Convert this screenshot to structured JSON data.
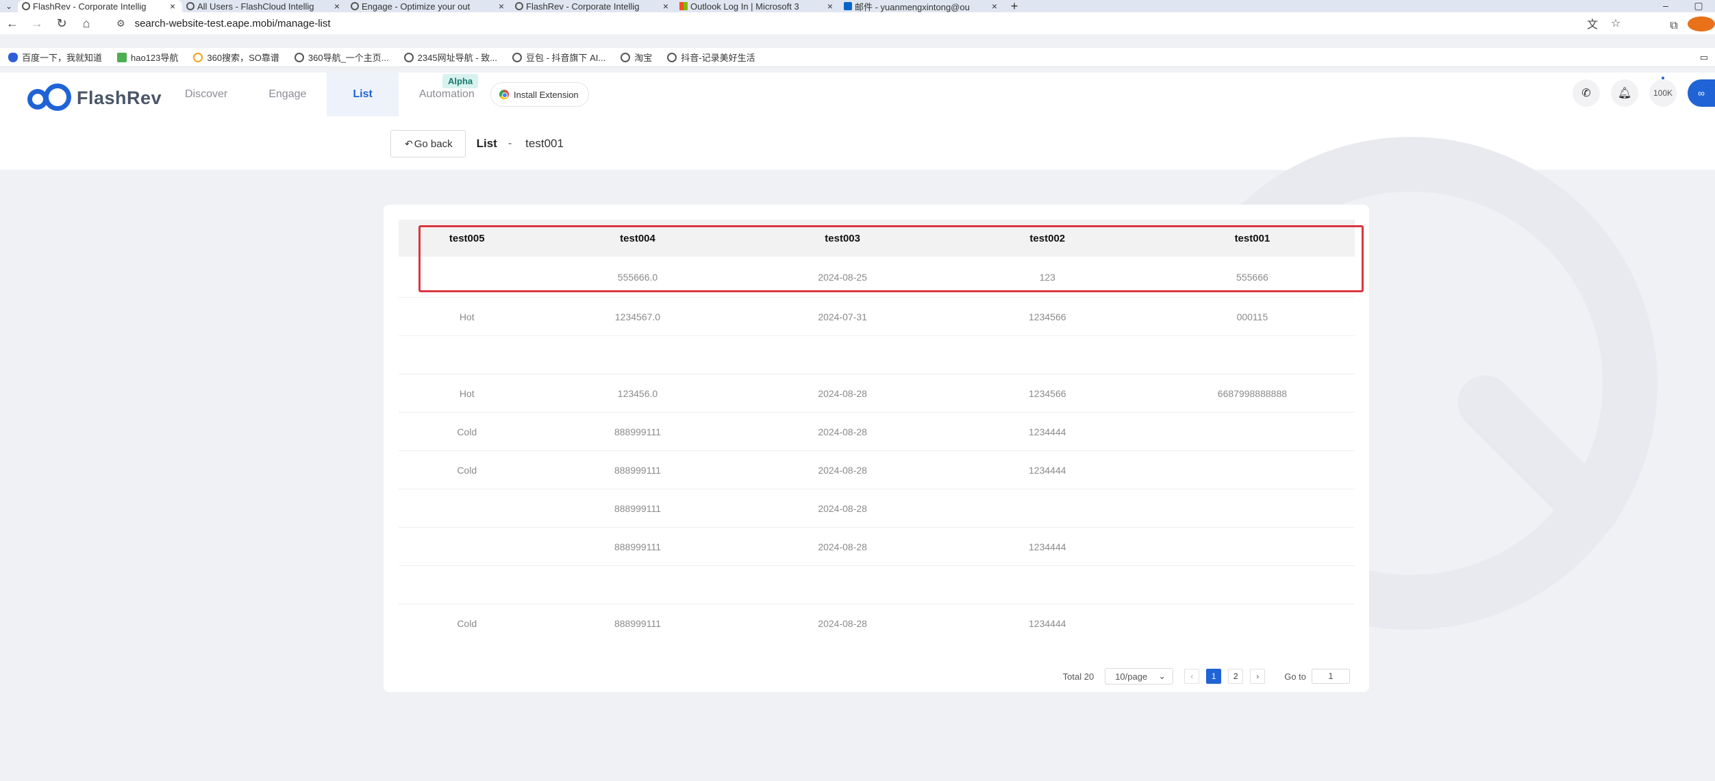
{
  "browser": {
    "tabs": [
      {
        "title": "FlashRev - Corporate Intellig",
        "active": true,
        "icon": "flashrev-icon"
      },
      {
        "title": "All Users - FlashCloud Intellig",
        "active": false,
        "icon": "globe-icon"
      },
      {
        "title": "Engage - Optimize your out",
        "active": false,
        "icon": "flashrev-icon"
      },
      {
        "title": "FlashRev - Corporate Intellig",
        "active": false,
        "icon": "flashrev-icon"
      },
      {
        "title": "Outlook Log In | Microsoft 3",
        "active": false,
        "icon": "microsoft-icon"
      },
      {
        "title": "邮件 - yuanmengxintong@ou",
        "active": false,
        "icon": "outlook-icon"
      }
    ],
    "new_tab": "+",
    "url": "search-website-test.eape.mobi/manage-list",
    "bookmarks": [
      "百度一下，我就知道",
      "hao123导航",
      "360搜索，SO靠谱",
      "360导航_一个主页...",
      "2345网址导航 - 致...",
      "豆包 - 抖音旗下 AI...",
      "淘宝",
      "抖音-记录美好生活"
    ]
  },
  "header": {
    "logo_text": "FlashRev",
    "nav": [
      {
        "label": "Discover",
        "active": false
      },
      {
        "label": "Engage",
        "active": false
      },
      {
        "label": "List",
        "active": true
      },
      {
        "label": "Automation",
        "active": false
      }
    ],
    "alpha_badge": "Alpha",
    "install_extension": "Install Extension",
    "credits": "100K"
  },
  "subheader": {
    "go_back": "Go back",
    "crumb_list": "List",
    "crumb_sep": "-",
    "crumb_name": "test001"
  },
  "table": {
    "columns": [
      "test005",
      "test004",
      "test003",
      "test002",
      "test001"
    ],
    "rows": [
      [
        "",
        "555666.0",
        "2024-08-25",
        "123",
        "555666"
      ],
      [
        "Hot",
        "1234567.0",
        "2024-07-31",
        "1234566",
        "000115"
      ],
      [
        "",
        "",
        "",
        "",
        ""
      ],
      [
        "Hot",
        "123456.0",
        "2024-08-28",
        "1234566",
        "6687998888888"
      ],
      [
        "Cold",
        "888999111",
        "2024-08-28",
        "1234444",
        ""
      ],
      [
        "Cold",
        "888999111",
        "2024-08-28",
        "1234444",
        ""
      ],
      [
        "",
        "888999111",
        "2024-08-28",
        "",
        ""
      ],
      [
        "",
        "888999111",
        "2024-08-28",
        "1234444",
        ""
      ],
      [
        "",
        "",
        "",
        "",
        ""
      ],
      [
        "Cold",
        "888999111",
        "2024-08-28",
        "1234444",
        ""
      ]
    ]
  },
  "pagination": {
    "total": "Total 20",
    "page_size": "10/page",
    "pages": [
      "1",
      "2"
    ],
    "current": "1",
    "goto_label": "Go to",
    "goto_value": "1"
  },
  "colors": {
    "brand": "#1f63d6",
    "highlight": "#d9363e",
    "page_bg": "#f0f1f5"
  }
}
